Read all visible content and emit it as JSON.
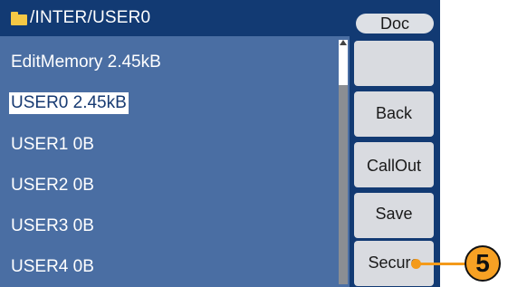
{
  "titlebar": {
    "path": "/INTER/USER0",
    "folder_icon": "folder-icon",
    "doc_label": "Doc"
  },
  "files": [
    {
      "label": "EditMemory  2.45kB",
      "selected": false
    },
    {
      "label": "USER0  2.45kB",
      "selected": true
    },
    {
      "label": "USER1  0B",
      "selected": false
    },
    {
      "label": "USER2  0B",
      "selected": false
    },
    {
      "label": "USER3  0B",
      "selected": false
    },
    {
      "label": "USER4  0B",
      "selected": false
    }
  ],
  "softkeys": [
    {
      "label": ""
    },
    {
      "label": "Back"
    },
    {
      "label": "CallOut"
    },
    {
      "label": "Save"
    },
    {
      "label": "Secure"
    }
  ],
  "callout": {
    "number": "5"
  },
  "colors": {
    "screen_bg": "#4a6ea3",
    "titlebar_bg": "#123a73",
    "softkey_bg": "#d9dbe0",
    "callout_orange": "#f7a124"
  }
}
